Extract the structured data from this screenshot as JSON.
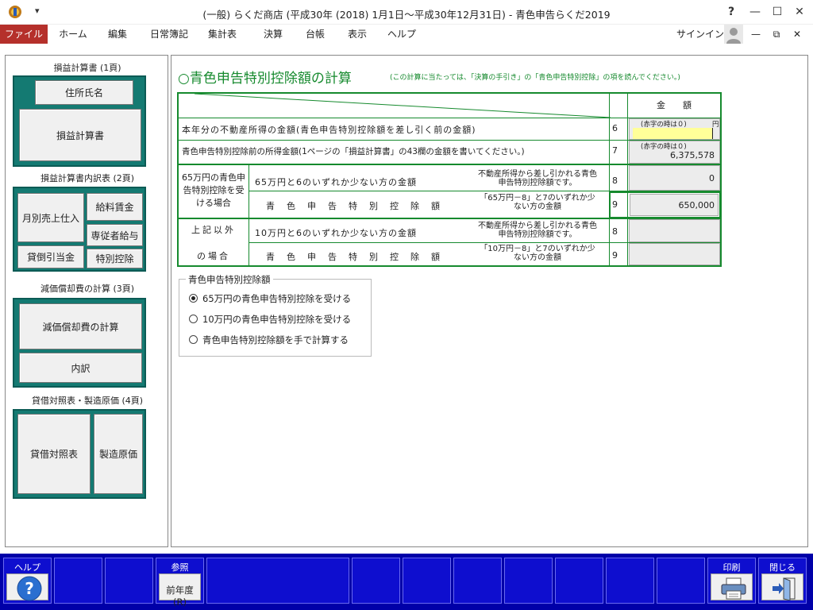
{
  "window": {
    "title": "(一般) らくだ商店 (平成30年 (2018) 1月1日～平成30年12月31日) - 青色申告らくだ2019",
    "qat_dropdown": "▾",
    "help": "?",
    "minimize": "—",
    "maximize": "☐",
    "close": "✕"
  },
  "menu": {
    "items": [
      "ファイル",
      "ホーム",
      "編集",
      "日常簿記",
      "集計表",
      "決算",
      "台帳",
      "表示",
      "ヘルプ"
    ],
    "signin": "サインイン",
    "ribbon_min": "—",
    "ribbon_restore": "⧉",
    "ribbon_close": "✕"
  },
  "sidebar": {
    "sec1_title": "損益計算書 (1頁)",
    "sec1_btn1": "住所氏名",
    "sec1_btn2": "損益計算書",
    "sec2_title": "損益計算書内訳表 (2頁)",
    "sec2_btn1": "月別売上仕入",
    "sec2_btn2": "給料賃金",
    "sec2_btn3": "専従者給与",
    "sec2_btn4": "貸倒引当金",
    "sec2_btn5": "特別控除",
    "sec3_title": "減価償却費の計算 (3頁)",
    "sec3_btn1": "減価償却費の計算",
    "sec3_btn2": "内訳",
    "sec4_title": "貸借対照表・製造原価 (4頁)",
    "sec4_btn1": "貸借対照表",
    "sec4_btn2": "製造原価"
  },
  "form": {
    "heading": "○青色申告特別控除額の計算",
    "note": "(この計算に当たっては、「決算の手引き」の「青色申告特別控除」の項を読んでください。)",
    "amount_header": "金　　額",
    "row6_label": "本年分の不動産所得の金額(青色申告特別控除額を差し引く前の金額)",
    "row6_num": "6",
    "row6_hint": "(赤字の時は０)",
    "row6_unit": "円",
    "row6_value": "",
    "row7_label": "青色申告特別控除前の所得金額(1ページの「損益計算書」の43欄の金額を書いてください。)",
    "row7_num": "7",
    "row7_hint": "(赤字の時は０)",
    "row7_value": "6,375,578",
    "group65_label": "65万円の青色申告特別控除を受ける場合",
    "row8a_label": "65万円と6のいずれか少ない方の金額",
    "row8a_note": "不動産所得から差し引かれる青色申告特別控除額です。",
    "row8a_num": "8",
    "row8a_value": "0",
    "row9a_label": "青　色　申　告　特　別　控　除　額",
    "row9a_note": "「65万円－8」と7のいずれか少ない方の金額",
    "row9a_num": "9",
    "row9a_value": "650,000",
    "group_other_label1": "上記以外",
    "group_other_label2": "の場合",
    "row8b_label": "10万円と6のいずれか少ない方の金額",
    "row8b_note": "不動産所得から差し引かれる青色申告特別控除額です。",
    "row8b_num": "8",
    "row8b_value": "",
    "row9b_label": "青　色　申　告　特　別　控　除　額",
    "row9b_note": "「10万円－8」と7のいずれか少ない方の金額",
    "row9b_num": "9",
    "row9b_value": ""
  },
  "options": {
    "group_title": "青色申告特別控除額",
    "opt1": "65万円の青色申告特別控除を受ける",
    "opt2": "10万円の青色申告特別控除を受ける",
    "opt3": "青色申告特別控除額を手で計算する",
    "selected": 1
  },
  "toolbar": {
    "help_caption": "ヘルプ",
    "ref_caption": "参照",
    "prev_year": "前年度(R)",
    "print_caption": "印刷",
    "close_caption": "閉じる"
  },
  "colors": {
    "form_green": "#168a2e",
    "teal": "#147a72",
    "toolbar_blue": "#0000a8",
    "file_menu_red": "#b5302b",
    "input_yellow": "#ffff99"
  }
}
